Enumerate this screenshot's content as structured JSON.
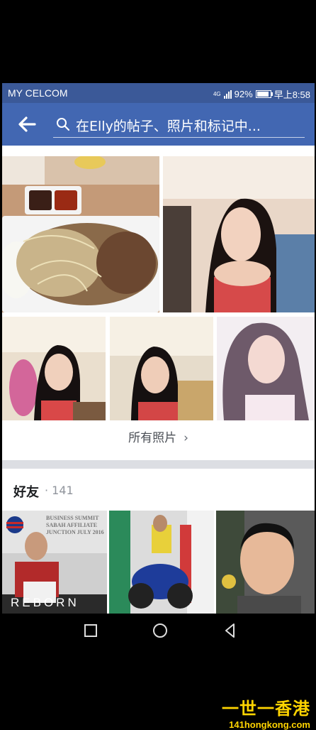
{
  "status_bar": {
    "carrier": "MY CELCOM",
    "network": "4G",
    "battery": "92%",
    "time": "早上8:58"
  },
  "search": {
    "placeholder": "在Elly的帖子、照片和标记中..."
  },
  "photos_section": {
    "all_photos_label": "所有照片",
    "chevron": "›"
  },
  "friends_section": {
    "title": "好友",
    "count": "· 141"
  },
  "friend_tiles": {
    "tile1_text": "REBORN",
    "tile1_banner": "BUSINESS SUMMIT SABAH AFFILIATE JUNCTION JULY 2016"
  },
  "watermark": {
    "line1": "一世一香港",
    "line2": "141hongkong.com"
  },
  "colors": {
    "status_bar": "#3b5998",
    "header": "#4267b2"
  },
  "icons": [
    "back-arrow-icon",
    "search-icon",
    "chevron-right-icon",
    "square-nav-icon",
    "circle-nav-icon",
    "triangle-nav-icon"
  ]
}
